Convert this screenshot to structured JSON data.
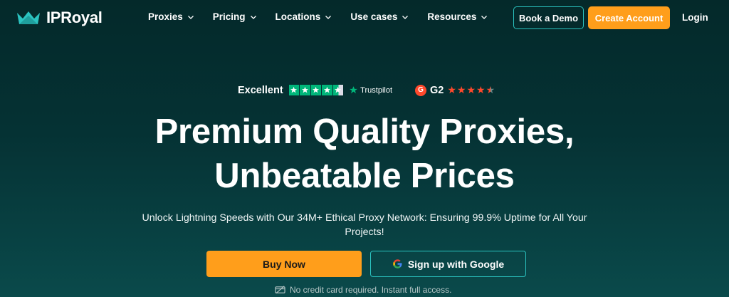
{
  "brand": {
    "name": "IPRoyal",
    "accent": "#2bc3c0",
    "cta": "#ff9e1b"
  },
  "nav": {
    "items": [
      {
        "label": "Proxies"
      },
      {
        "label": "Pricing"
      },
      {
        "label": "Locations"
      },
      {
        "label": "Use cases"
      },
      {
        "label": "Resources"
      }
    ],
    "book_demo": "Book a Demo",
    "create_account": "Create Account",
    "login": "Login"
  },
  "ratings": {
    "trustpilot_label": "Excellent",
    "trustpilot_brand": "Trustpilot",
    "trustpilot_stars": 4.5,
    "g2_label": "G2",
    "g2_stars": 4.5
  },
  "hero": {
    "headline_line1": "Premium Quality Proxies,",
    "headline_line2": "Unbeatable Prices",
    "subtitle": "Unlock Lightning Speeds with Our 34M+ Ethical Proxy Network: Ensuring 99.9% Uptime for All Your Projects!",
    "buy_now": "Buy Now",
    "google_signup": "Sign up with Google",
    "note": "No credit card required. Instant full access."
  },
  "icons": {
    "logo": "crown-logo-icon",
    "chevron": "chevron-down-icon",
    "trustpilot": "trustpilot-star-icon",
    "g2": "g2-logo-icon",
    "google": "google-logo-icon",
    "card": "card-off-icon"
  }
}
